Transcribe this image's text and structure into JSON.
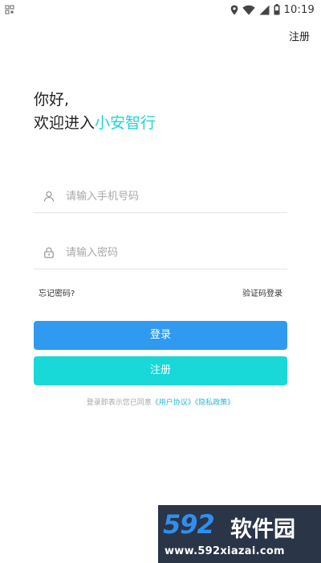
{
  "status_bar": {
    "time": "10:19",
    "icons": [
      "notification-icon",
      "location-icon",
      "wifi-icon",
      "signal-icon",
      "battery-icon"
    ]
  },
  "header": {
    "register_link": "注册"
  },
  "greeting": {
    "line1": "你好,",
    "line2_prefix": "欢迎进入",
    "brand": "小安智行",
    "brand_color": "#1fd3d3"
  },
  "form": {
    "phone": {
      "placeholder": "请输入手机号码",
      "value": "",
      "icon": "user-icon"
    },
    "password": {
      "placeholder": "请输入密码",
      "value": "",
      "icon": "lock-icon"
    },
    "forgot_password": "忘记密码?",
    "sms_login": "验证码登录"
  },
  "buttons": {
    "login": "登录",
    "register": "注册",
    "login_color": "#2f9af0",
    "register_color": "#18d8d8"
  },
  "agreement": {
    "prefix": "登录即表示您已同意",
    "user_agreement": "《用户协议》",
    "privacy_policy": "《隐私政策》",
    "link_color": "#27b8d8"
  },
  "watermark": {
    "number": "592",
    "name": "软件园",
    "url": "www.592xiazai.com"
  }
}
